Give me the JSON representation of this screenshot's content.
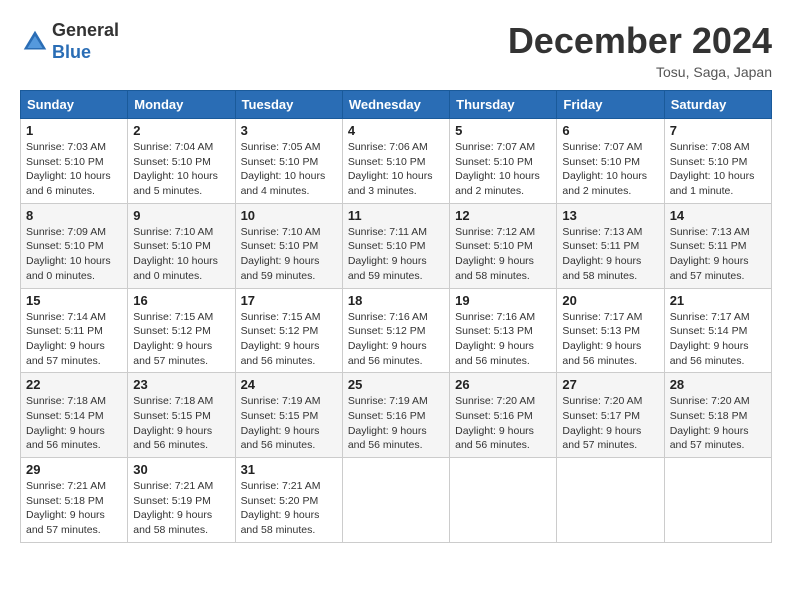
{
  "header": {
    "logo_line1": "General",
    "logo_line2": "Blue",
    "month_year": "December 2024",
    "location": "Tosu, Saga, Japan"
  },
  "weekdays": [
    "Sunday",
    "Monday",
    "Tuesday",
    "Wednesday",
    "Thursday",
    "Friday",
    "Saturday"
  ],
  "weeks": [
    [
      {
        "day": "1",
        "sunrise": "7:03 AM",
        "sunset": "5:10 PM",
        "daylight": "10 hours and 6 minutes."
      },
      {
        "day": "2",
        "sunrise": "7:04 AM",
        "sunset": "5:10 PM",
        "daylight": "10 hours and 5 minutes."
      },
      {
        "day": "3",
        "sunrise": "7:05 AM",
        "sunset": "5:10 PM",
        "daylight": "10 hours and 4 minutes."
      },
      {
        "day": "4",
        "sunrise": "7:06 AM",
        "sunset": "5:10 PM",
        "daylight": "10 hours and 3 minutes."
      },
      {
        "day": "5",
        "sunrise": "7:07 AM",
        "sunset": "5:10 PM",
        "daylight": "10 hours and 2 minutes."
      },
      {
        "day": "6",
        "sunrise": "7:07 AM",
        "sunset": "5:10 PM",
        "daylight": "10 hours and 2 minutes."
      },
      {
        "day": "7",
        "sunrise": "7:08 AM",
        "sunset": "5:10 PM",
        "daylight": "10 hours and 1 minute."
      }
    ],
    [
      {
        "day": "8",
        "sunrise": "7:09 AM",
        "sunset": "5:10 PM",
        "daylight": "10 hours and 0 minutes."
      },
      {
        "day": "9",
        "sunrise": "7:10 AM",
        "sunset": "5:10 PM",
        "daylight": "10 hours and 0 minutes."
      },
      {
        "day": "10",
        "sunrise": "7:10 AM",
        "sunset": "5:10 PM",
        "daylight": "9 hours and 59 minutes."
      },
      {
        "day": "11",
        "sunrise": "7:11 AM",
        "sunset": "5:10 PM",
        "daylight": "9 hours and 59 minutes."
      },
      {
        "day": "12",
        "sunrise": "7:12 AM",
        "sunset": "5:10 PM",
        "daylight": "9 hours and 58 minutes."
      },
      {
        "day": "13",
        "sunrise": "7:13 AM",
        "sunset": "5:11 PM",
        "daylight": "9 hours and 58 minutes."
      },
      {
        "day": "14",
        "sunrise": "7:13 AM",
        "sunset": "5:11 PM",
        "daylight": "9 hours and 57 minutes."
      }
    ],
    [
      {
        "day": "15",
        "sunrise": "7:14 AM",
        "sunset": "5:11 PM",
        "daylight": "9 hours and 57 minutes."
      },
      {
        "day": "16",
        "sunrise": "7:15 AM",
        "sunset": "5:12 PM",
        "daylight": "9 hours and 57 minutes."
      },
      {
        "day": "17",
        "sunrise": "7:15 AM",
        "sunset": "5:12 PM",
        "daylight": "9 hours and 56 minutes."
      },
      {
        "day": "18",
        "sunrise": "7:16 AM",
        "sunset": "5:12 PM",
        "daylight": "9 hours and 56 minutes."
      },
      {
        "day": "19",
        "sunrise": "7:16 AM",
        "sunset": "5:13 PM",
        "daylight": "9 hours and 56 minutes."
      },
      {
        "day": "20",
        "sunrise": "7:17 AM",
        "sunset": "5:13 PM",
        "daylight": "9 hours and 56 minutes."
      },
      {
        "day": "21",
        "sunrise": "7:17 AM",
        "sunset": "5:14 PM",
        "daylight": "9 hours and 56 minutes."
      }
    ],
    [
      {
        "day": "22",
        "sunrise": "7:18 AM",
        "sunset": "5:14 PM",
        "daylight": "9 hours and 56 minutes."
      },
      {
        "day": "23",
        "sunrise": "7:18 AM",
        "sunset": "5:15 PM",
        "daylight": "9 hours and 56 minutes."
      },
      {
        "day": "24",
        "sunrise": "7:19 AM",
        "sunset": "5:15 PM",
        "daylight": "9 hours and 56 minutes."
      },
      {
        "day": "25",
        "sunrise": "7:19 AM",
        "sunset": "5:16 PM",
        "daylight": "9 hours and 56 minutes."
      },
      {
        "day": "26",
        "sunrise": "7:20 AM",
        "sunset": "5:16 PM",
        "daylight": "9 hours and 56 minutes."
      },
      {
        "day": "27",
        "sunrise": "7:20 AM",
        "sunset": "5:17 PM",
        "daylight": "9 hours and 57 minutes."
      },
      {
        "day": "28",
        "sunrise": "7:20 AM",
        "sunset": "5:18 PM",
        "daylight": "9 hours and 57 minutes."
      }
    ],
    [
      {
        "day": "29",
        "sunrise": "7:21 AM",
        "sunset": "5:18 PM",
        "daylight": "9 hours and 57 minutes."
      },
      {
        "day": "30",
        "sunrise": "7:21 AM",
        "sunset": "5:19 PM",
        "daylight": "9 hours and 58 minutes."
      },
      {
        "day": "31",
        "sunrise": "7:21 AM",
        "sunset": "5:20 PM",
        "daylight": "9 hours and 58 minutes."
      },
      null,
      null,
      null,
      null
    ]
  ],
  "labels": {
    "sunrise": "Sunrise:",
    "sunset": "Sunset:",
    "daylight": "Daylight:"
  }
}
